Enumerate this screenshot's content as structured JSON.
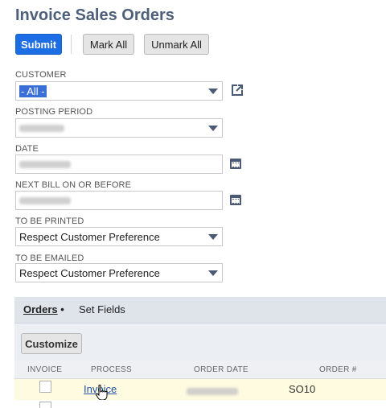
{
  "page": {
    "title": "Invoice Sales Orders"
  },
  "toolbar": {
    "submit_label": "Submit",
    "mark_all_label": "Mark All",
    "unmark_all_label": "Unmark All"
  },
  "form": {
    "customer": {
      "label": "CUSTOMER",
      "value": "- All -"
    },
    "posting_period": {
      "label": "POSTING PERIOD",
      "value": ""
    },
    "date": {
      "label": "DATE",
      "value": ""
    },
    "next_bill": {
      "label": "NEXT BILL ON OR BEFORE",
      "value": ""
    },
    "to_be_printed": {
      "label": "TO BE PRINTED",
      "value": "Respect Customer Preference"
    },
    "to_be_emailed": {
      "label": "TO BE EMAILED",
      "value": "Respect Customer Preference"
    }
  },
  "tabs": [
    {
      "label": "Orders",
      "suffix": " •",
      "active": true
    },
    {
      "label": "Set Fields",
      "active": false
    }
  ],
  "sublist": {
    "customize_label": "Customize",
    "columns": [
      "INVOICE",
      "PROCESS",
      "ORDER DATE",
      "ORDER #"
    ],
    "rows": [
      {
        "invoice_checked": false,
        "process": "Invoice",
        "order_date": "",
        "order_number": "SO10"
      }
    ]
  },
  "colors": {
    "primary_button": "#1d6de5",
    "title": "#4d5f79",
    "icon": "#4a5a74",
    "row_highlight": "#fffbe0"
  },
  "icons": [
    "caret-down-icon",
    "open-external-icon",
    "calendar-icon",
    "hand-pointer-cursor"
  ]
}
